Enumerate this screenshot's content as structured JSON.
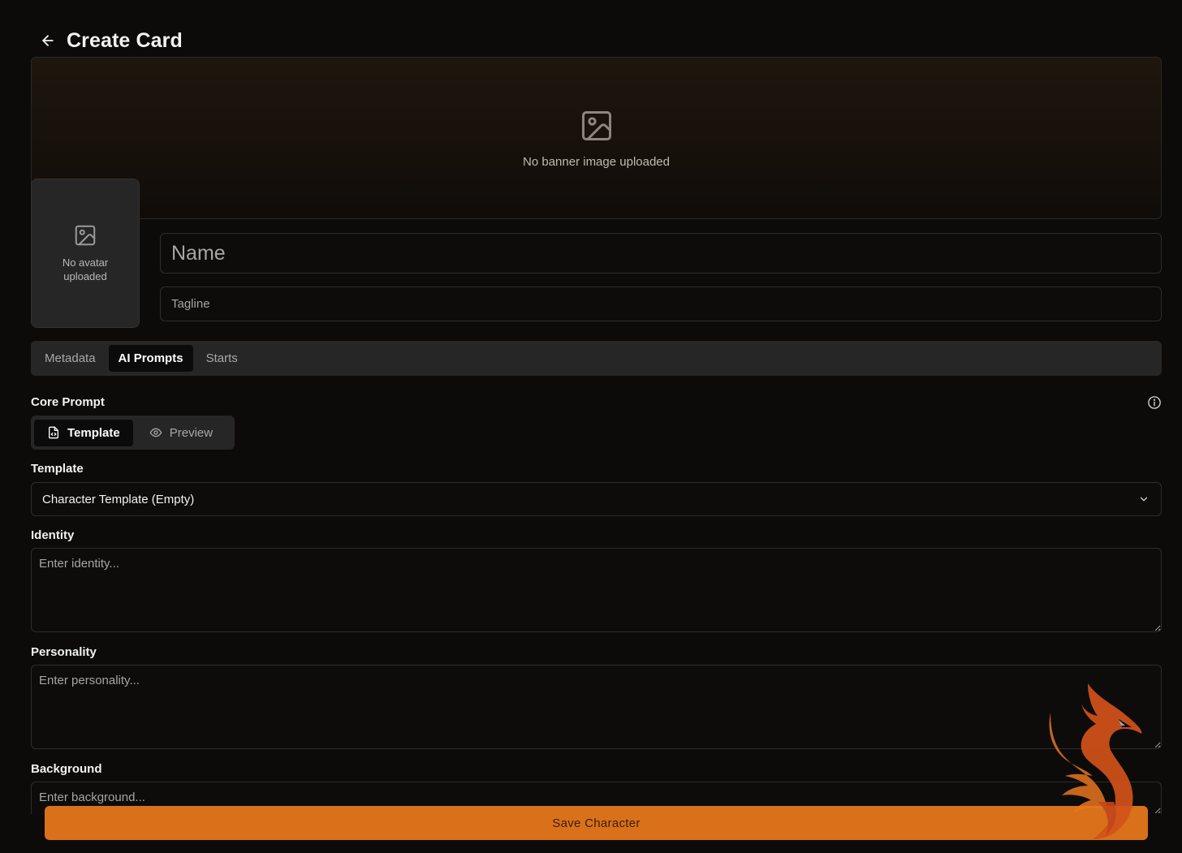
{
  "header": {
    "title": "Create Card"
  },
  "banner": {
    "empty_text": "No banner image uploaded"
  },
  "avatar": {
    "empty_text": "No avatar uploaded"
  },
  "fields": {
    "name_placeholder": "Name",
    "tagline_placeholder": "Tagline"
  },
  "tabs": [
    {
      "label": "Metadata",
      "active": false
    },
    {
      "label": "AI Prompts",
      "active": true
    },
    {
      "label": "Starts",
      "active": false
    }
  ],
  "core_prompt": {
    "label": "Core Prompt",
    "modes": [
      {
        "label": "Template",
        "icon": "file-code-icon",
        "active": true
      },
      {
        "label": "Preview",
        "icon": "eye-icon",
        "active": false
      }
    ]
  },
  "template": {
    "label": "Template",
    "selected": "Character Template (Empty)"
  },
  "identity": {
    "label": "Identity",
    "placeholder": "Enter identity..."
  },
  "personality": {
    "label": "Personality",
    "placeholder": "Enter personality..."
  },
  "background": {
    "label": "Background",
    "placeholder": "Enter background..."
  },
  "actions": {
    "save_label": "Save Character"
  },
  "colors": {
    "accent": "#d9711b",
    "background": "#0c0b0a",
    "panel": "#262626",
    "logo_primary": "#d2521a",
    "logo_secondary": "#e8751f"
  }
}
